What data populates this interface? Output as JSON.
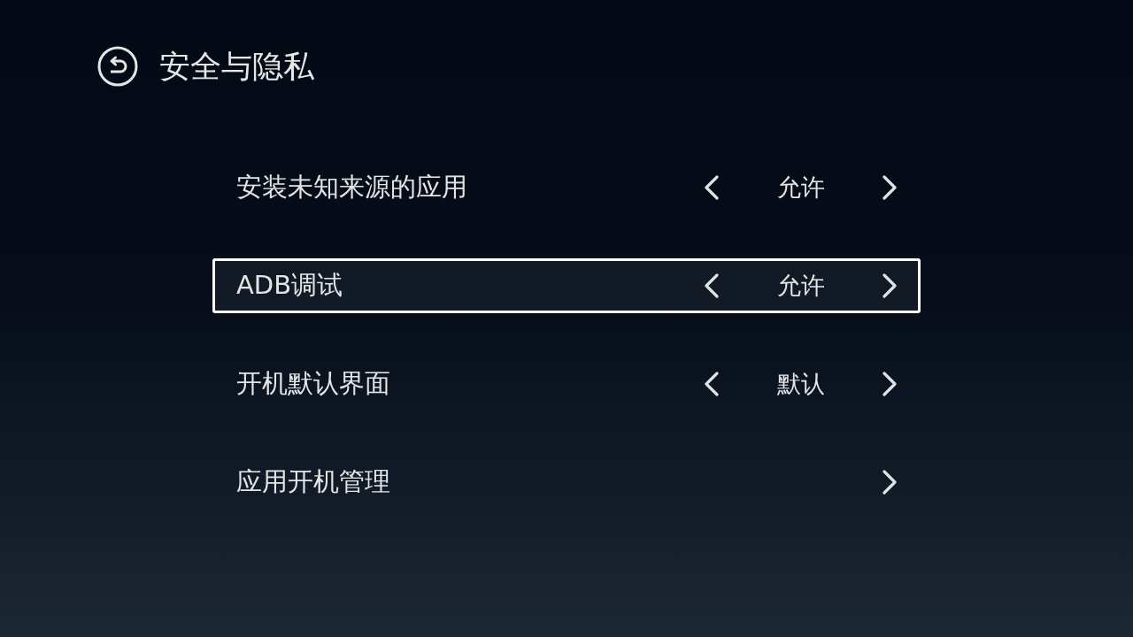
{
  "header": {
    "title": "安全与隐私"
  },
  "rows": [
    {
      "kind": "selector",
      "label": "安装未知来源的应用",
      "value": "允许",
      "selected": false
    },
    {
      "kind": "selector",
      "label": "ADB调试",
      "value": "允许",
      "selected": true
    },
    {
      "kind": "selector",
      "label": "开机默认界面",
      "value": "默认",
      "selected": false
    },
    {
      "kind": "link",
      "label": "应用开机管理",
      "selected": false
    }
  ]
}
